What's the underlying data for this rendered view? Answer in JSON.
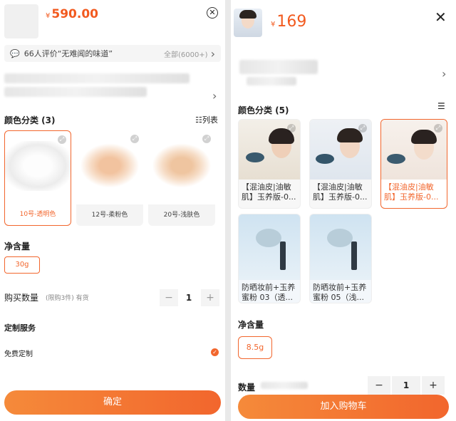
{
  "left": {
    "price_currency": "¥",
    "price_value": "590.00",
    "review_text": "66人评价“无难闻的味道”",
    "review_all": "全部(6000+)",
    "color_section": "颜色分类 (3)",
    "list_view_label": "列表",
    "swatches": [
      {
        "label": "10号-透明色"
      },
      {
        "label": "12号-柔粉色"
      },
      {
        "label": "20号-浅肤色"
      }
    ],
    "net_content_title": "净含量",
    "net_content_value": "30g",
    "qty_title": "购买数量",
    "qty_note": "(限购3件) 有货",
    "qty_value": "1",
    "minus": "−",
    "plus": "+",
    "custom_title": "定制服务",
    "custom_option": "免费定制",
    "confirm_label": "确定"
  },
  "right": {
    "price_currency": "¥",
    "price_value": "169",
    "color_section": "颜色分类 (5)",
    "cards": [
      {
        "label": "【混油皮|油敏肌】玉养版-0..."
      },
      {
        "label": "【混油皮|油敏肌】玉养版-0..."
      },
      {
        "label": "【混油皮|油敏肌】玉养版-0..."
      },
      {
        "label": "防晒妆前+玉养蜜粉 03（透..."
      },
      {
        "label": "防晒妆前+玉养蜜粉 05（浅..."
      }
    ],
    "net_content_title": "净含量",
    "net_content_value": "8.5g",
    "qty_title": "数量",
    "qty_value": "1",
    "minus": "−",
    "plus": "+",
    "add_cart_label": "加入购物车"
  },
  "colors": {
    "accent": "#f2662d"
  }
}
